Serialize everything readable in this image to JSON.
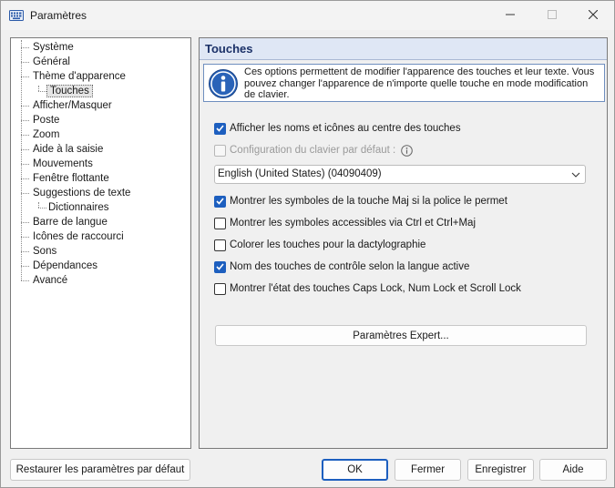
{
  "window": {
    "title": "Paramètres"
  },
  "tree": {
    "items": [
      {
        "label": "Système",
        "level": 0
      },
      {
        "label": "Général",
        "level": 0
      },
      {
        "label": "Thème d'apparence",
        "level": 0
      },
      {
        "label": "Touches",
        "level": 1,
        "selected": true
      },
      {
        "label": "Afficher/Masquer",
        "level": 0
      },
      {
        "label": "Poste",
        "level": 0
      },
      {
        "label": "Zoom",
        "level": 0
      },
      {
        "label": "Aide à la saisie",
        "level": 0
      },
      {
        "label": "Mouvements",
        "level": 0
      },
      {
        "label": "Fenêtre flottante",
        "level": 0
      },
      {
        "label": "Suggestions de texte",
        "level": 0
      },
      {
        "label": "Dictionnaires",
        "level": 1
      },
      {
        "label": "Barre de langue",
        "level": 0
      },
      {
        "label": "Icônes de raccourci",
        "level": 0
      },
      {
        "label": "Sons",
        "level": 0
      },
      {
        "label": "Dépendances",
        "level": 0
      },
      {
        "label": "Avancé",
        "level": 0
      }
    ]
  },
  "panel": {
    "title": "Touches",
    "info": "Ces options permettent de modifier l'apparence des touches et leur texte. Vous pouvez changer l'apparence de n'importe quelle touche en mode modification de clavier.",
    "options": [
      {
        "label": "Afficher les noms et icônes au centre des touches",
        "checked": true,
        "disabled": false
      },
      {
        "label": "Configuration du clavier par défaut :",
        "checked": false,
        "disabled": true
      },
      {
        "label": "Montrer les symboles de la touche Maj si la police le permet",
        "checked": true,
        "disabled": false
      },
      {
        "label": "Montrer les symboles accessibles via Ctrl et Ctrl+Maj",
        "checked": false,
        "disabled": false
      },
      {
        "label": "Colorer les touches pour la dactylographie",
        "checked": false,
        "disabled": false
      },
      {
        "label": "Nom des touches de contrôle selon la langue active",
        "checked": true,
        "disabled": false
      },
      {
        "label": "Montrer l'état des touches Caps Lock, Num Lock et Scroll Lock",
        "checked": false,
        "disabled": false
      }
    ],
    "layout_combo": {
      "value": "English (United States) (04090409)"
    },
    "expert_button": "Paramètres Expert..."
  },
  "buttons": {
    "restore": "Restaurer les paramètres par défaut",
    "ok": "OK",
    "close": "Fermer",
    "save": "Enregistrer",
    "help": "Aide"
  },
  "colors": {
    "accent": "#1d5fbf",
    "header_bg": "#dfe7f5",
    "header_text": "#1b3168"
  },
  "icons": {
    "app": "keyboard-icon",
    "info": "info-icon",
    "help": "help-icon",
    "dropdown": "chevron-down-icon"
  }
}
